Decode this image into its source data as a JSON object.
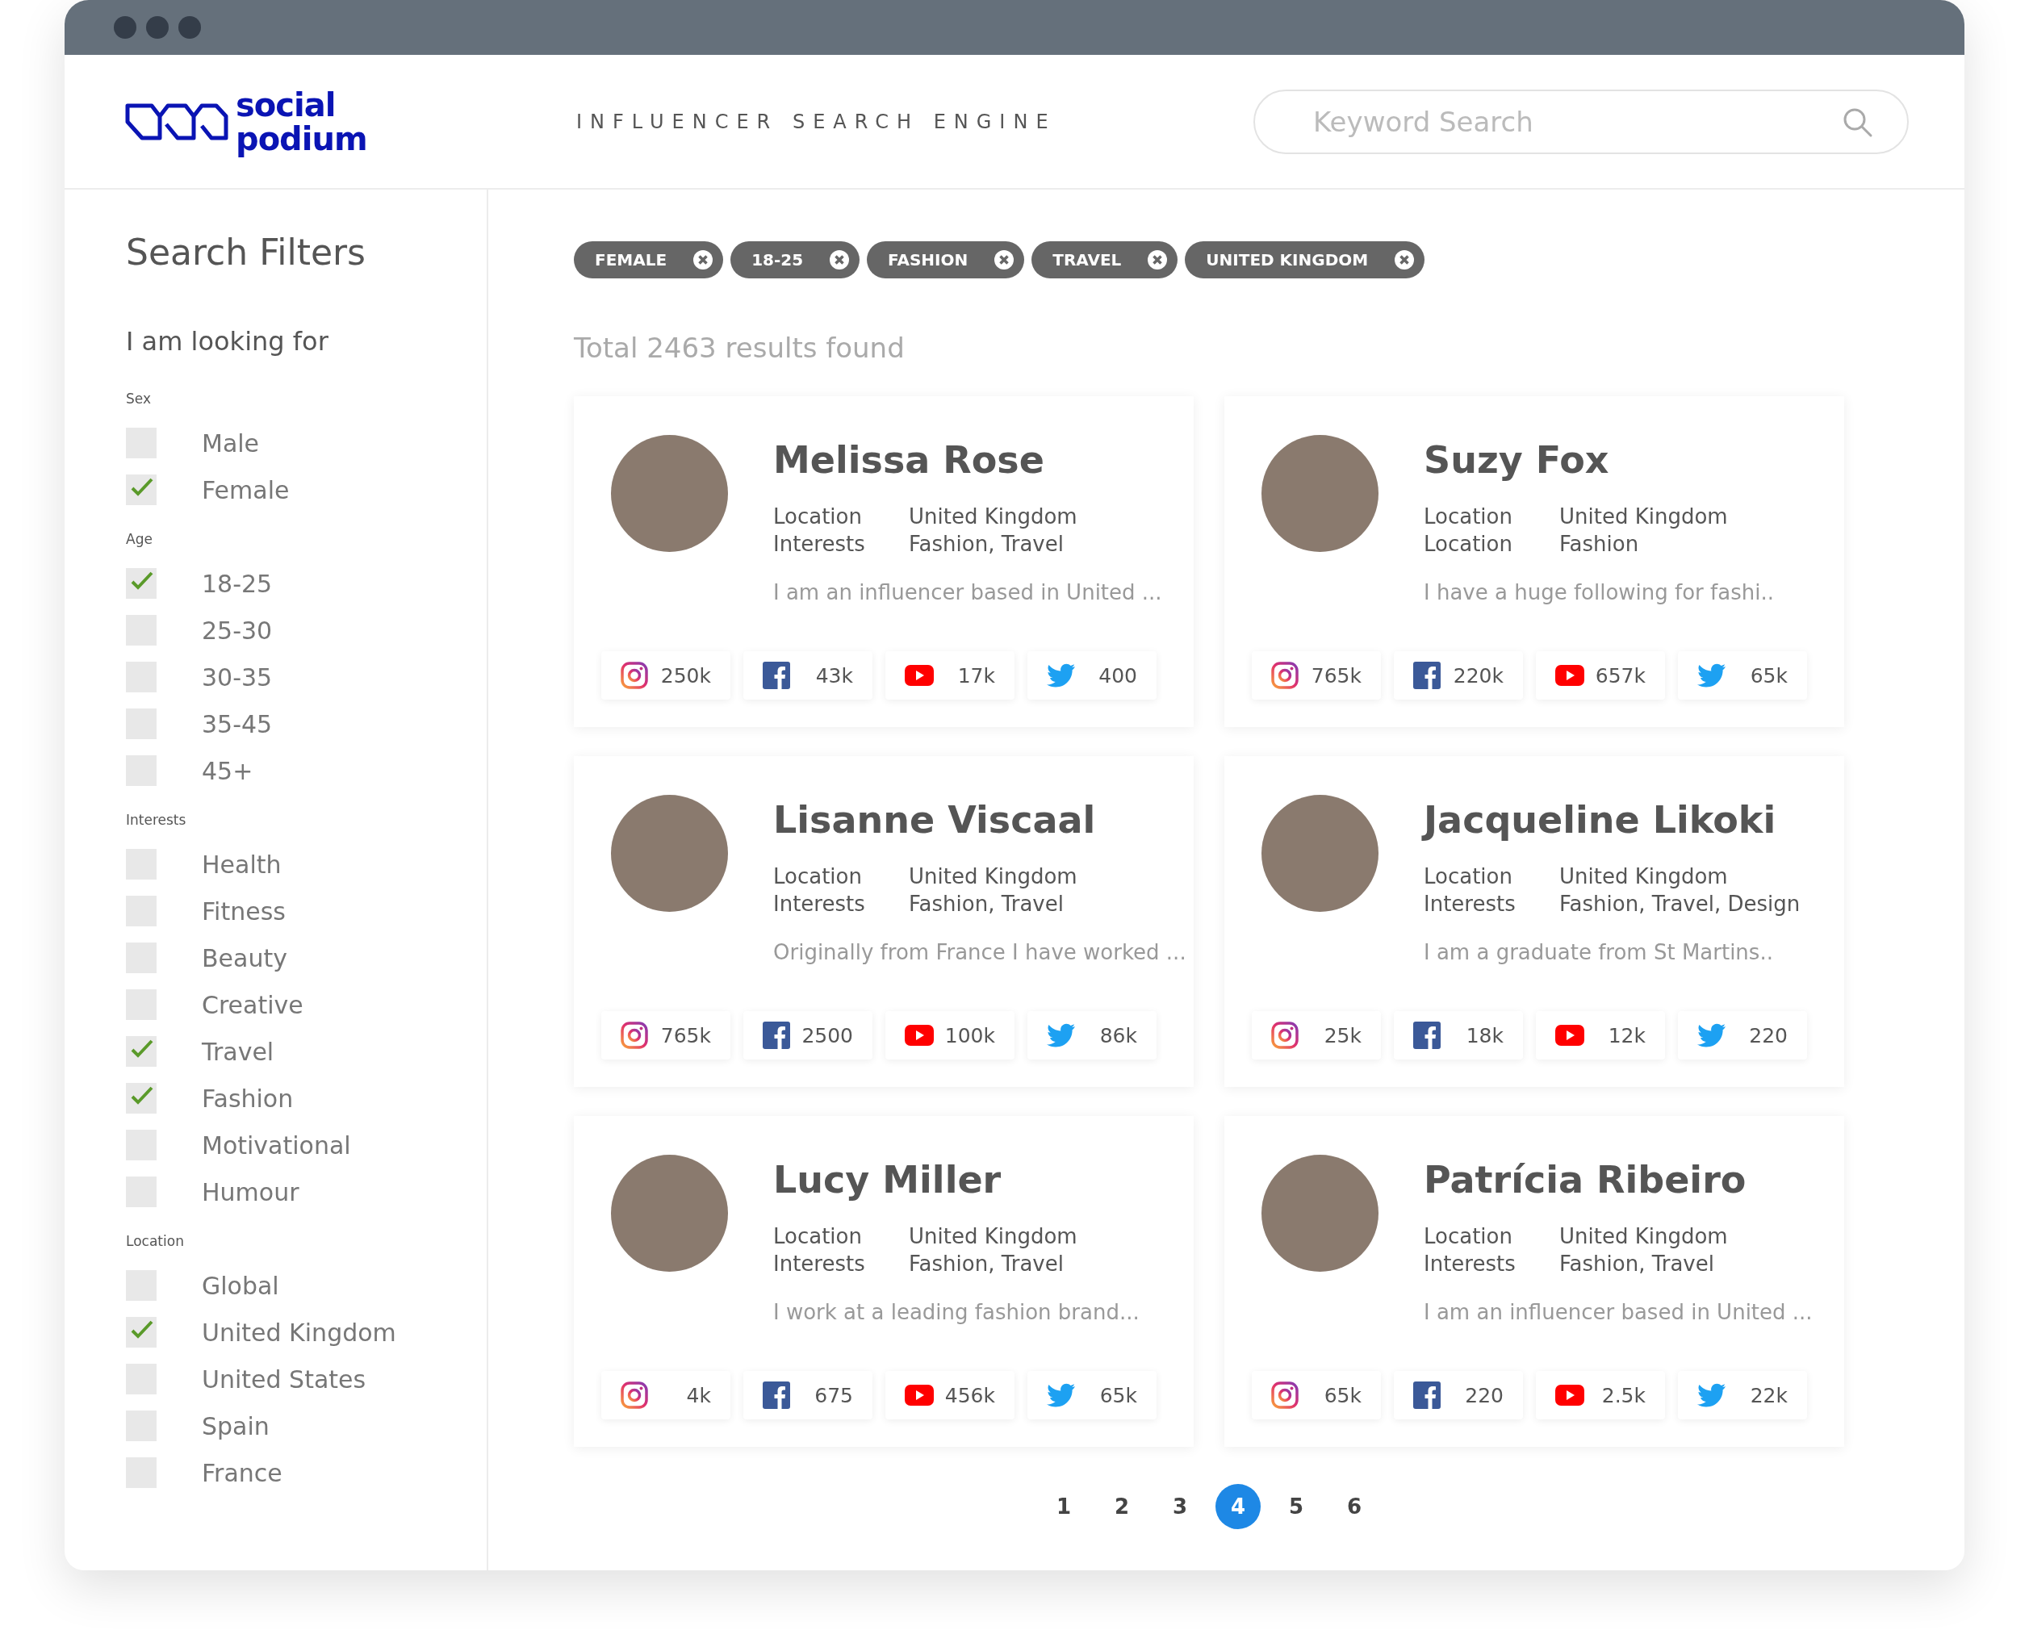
{
  "header": {
    "logo": "social\npodium",
    "tagline": "INFLUENCER SEARCH ENGINE",
    "search": {
      "placeholder": "Keyword Search"
    }
  },
  "sidebar": {
    "title": "Search Filters",
    "subtitle": "I am looking for",
    "groups": [
      {
        "heading": "Sex",
        "options": [
          {
            "label": "Male",
            "checked": false
          },
          {
            "label": "Female",
            "checked": true
          }
        ]
      },
      {
        "heading": "Age",
        "options": [
          {
            "label": "18-25",
            "checked": true
          },
          {
            "label": "25-30",
            "checked": false
          },
          {
            "label": "30-35",
            "checked": false
          },
          {
            "label": "35-45",
            "checked": false
          },
          {
            "label": "45+",
            "checked": false
          }
        ]
      },
      {
        "heading": "Interests",
        "options": [
          {
            "label": "Health",
            "checked": false
          },
          {
            "label": "Fitness",
            "checked": false
          },
          {
            "label": "Beauty",
            "checked": false
          },
          {
            "label": "Creative",
            "checked": false
          },
          {
            "label": "Travel",
            "checked": true
          },
          {
            "label": "Fashion",
            "checked": true
          },
          {
            "label": "Motivational",
            "checked": false
          },
          {
            "label": "Humour",
            "checked": false
          }
        ]
      },
      {
        "heading": "Location",
        "options": [
          {
            "label": "Global",
            "checked": false
          },
          {
            "label": "United Kingdom",
            "checked": true
          },
          {
            "label": "United States",
            "checked": false
          },
          {
            "label": "Spain",
            "checked": false
          },
          {
            "label": "France",
            "checked": false
          }
        ]
      }
    ]
  },
  "chips": [
    "FEMALE",
    "18-25",
    "FASHION",
    "TRAVEL",
    "UNITED KINGDOM"
  ],
  "results_count": "Total 2463 results found",
  "cards": [
    {
      "name": "Melissa Rose",
      "details": [
        {
          "label": "Location",
          "value": "United Kingdom"
        },
        {
          "label": "Interests",
          "value": "Fashion, Travel"
        }
      ],
      "bio": "I am an influencer based in United ...",
      "stats": [
        {
          "kind": "instagram",
          "value": "250k"
        },
        {
          "kind": "facebook",
          "value": "43k"
        },
        {
          "kind": "youtube",
          "value": "17k"
        },
        {
          "kind": "twitter",
          "value": "400"
        }
      ]
    },
    {
      "name": "Suzy Fox",
      "details": [
        {
          "label": "Location",
          "value": "United Kingdom"
        },
        {
          "label": "Location",
          "value": "Fashion"
        }
      ],
      "bio": "I have a huge following for fashi..",
      "stats": [
        {
          "kind": "instagram",
          "value": "765k"
        },
        {
          "kind": "facebook",
          "value": "220k"
        },
        {
          "kind": "youtube",
          "value": "657k"
        },
        {
          "kind": "twitter",
          "value": "65k"
        }
      ]
    },
    {
      "name": "Lisanne Viscaal",
      "details": [
        {
          "label": "Location",
          "value": "United Kingdom"
        },
        {
          "label": "Interests",
          "value": "Fashion, Travel"
        }
      ],
      "bio": "Originally from France I have worked ...",
      "stats": [
        {
          "kind": "instagram",
          "value": "765k"
        },
        {
          "kind": "facebook",
          "value": "2500"
        },
        {
          "kind": "youtube",
          "value": "100k"
        },
        {
          "kind": "twitter",
          "value": "86k"
        }
      ]
    },
    {
      "name": "Jacqueline Likoki",
      "details": [
        {
          "label": "Location",
          "value": "United Kingdom"
        },
        {
          "label": "Interests",
          "value": "Fashion, Travel, Design"
        }
      ],
      "bio": "I am a graduate from St Martins..",
      "stats": [
        {
          "kind": "instagram",
          "value": "25k"
        },
        {
          "kind": "facebook",
          "value": "18k"
        },
        {
          "kind": "youtube",
          "value": "12k"
        },
        {
          "kind": "twitter",
          "value": "220"
        }
      ]
    },
    {
      "name": "Lucy Miller",
      "details": [
        {
          "label": "Location",
          "value": "United Kingdom"
        },
        {
          "label": "Interests",
          "value": "Fashion, Travel"
        }
      ],
      "bio": "I work at a leading fashion brand...",
      "stats": [
        {
          "kind": "instagram",
          "value": "4k"
        },
        {
          "kind": "facebook",
          "value": "675"
        },
        {
          "kind": "youtube",
          "value": "456k"
        },
        {
          "kind": "twitter",
          "value": "65k"
        }
      ]
    },
    {
      "name": "Patrícia Ribeiro",
      "details": [
        {
          "label": "Location",
          "value": "United Kingdom"
        },
        {
          "label": "Interests",
          "value": "Fashion, Travel"
        }
      ],
      "bio": "I am an influencer based in United ...",
      "stats": [
        {
          "kind": "instagram",
          "value": "65k"
        },
        {
          "kind": "facebook",
          "value": "220"
        },
        {
          "kind": "youtube",
          "value": "2.5k"
        },
        {
          "kind": "twitter",
          "value": "22k"
        }
      ]
    }
  ],
  "pagination": [
    {
      "label": "1",
      "selected": false
    },
    {
      "label": "2",
      "selected": false
    },
    {
      "label": "3",
      "selected": false
    },
    {
      "label": "4",
      "selected": true
    },
    {
      "label": "5",
      "selected": false
    },
    {
      "label": "6",
      "selected": false
    }
  ]
}
